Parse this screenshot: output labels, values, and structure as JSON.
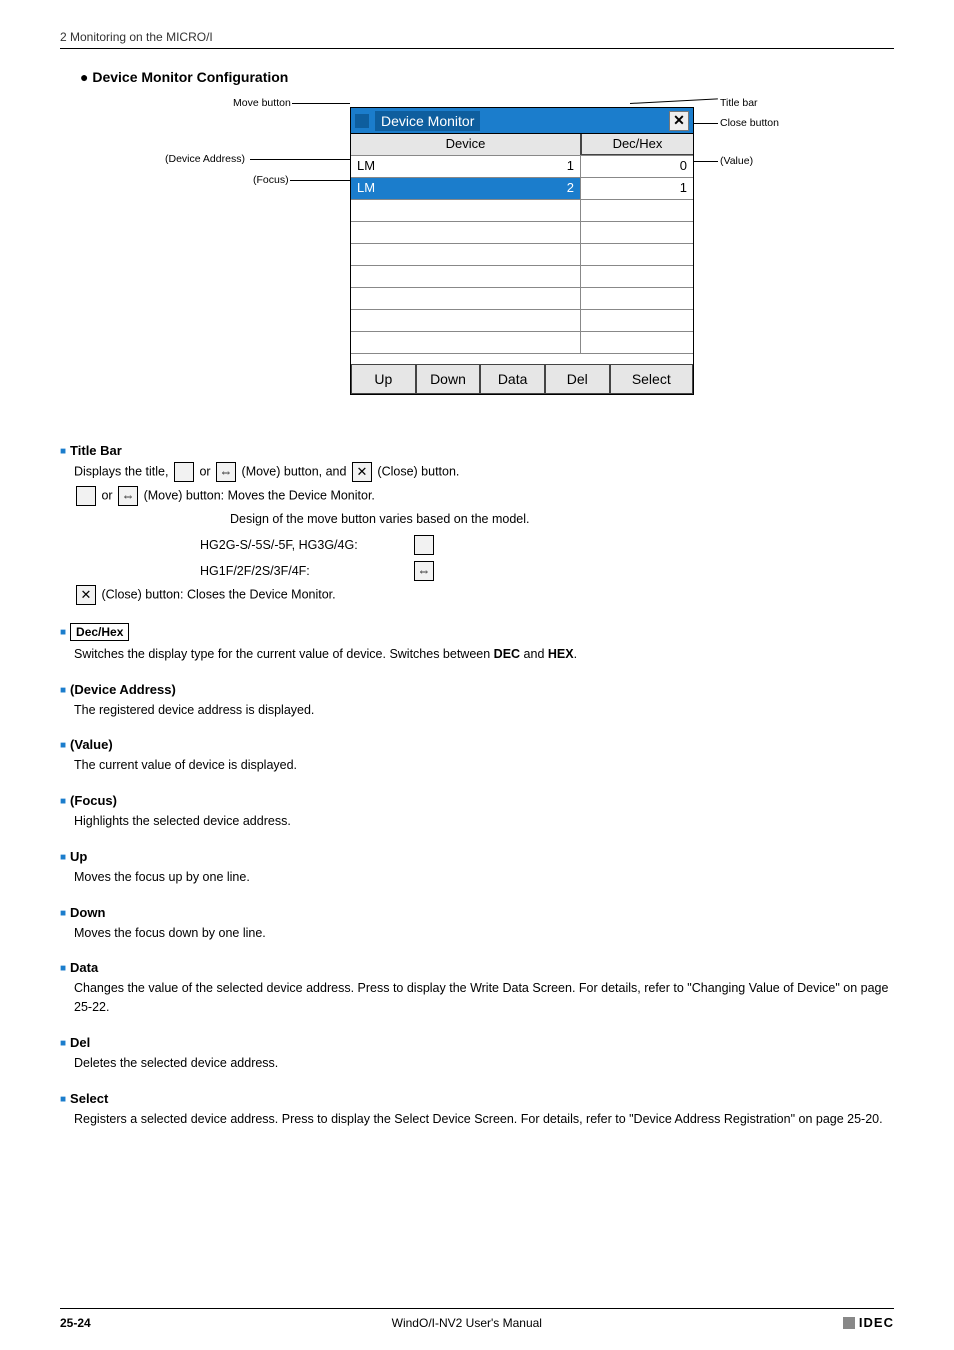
{
  "header": {
    "title": "2 Monitoring on the MICRO/I"
  },
  "section": {
    "title": "● Device Monitor Configuration"
  },
  "callouts": {
    "move_button": "Move button",
    "device_address": "(Device Address)",
    "focus": "(Focus)",
    "title_bar": "Title bar",
    "close_button": "Close button",
    "value": "(Value)"
  },
  "monitor": {
    "title": "Device Monitor",
    "close_glyph": "✕",
    "header_device": "Device",
    "header_dechex": "Dec/Hex",
    "rows": [
      {
        "addr": "LM",
        "num": "1",
        "val": "0"
      },
      {
        "addr": "LM",
        "num": "2",
        "val": "1"
      }
    ],
    "buttons": {
      "up": "Up",
      "down": "Down",
      "data": "Data",
      "del": "Del",
      "select": "Select"
    }
  },
  "definitions": {
    "title_bar": {
      "heading": "Title Bar",
      "line1_prefix": "Displays the title, ",
      "line1_or": " or ",
      "move_glyph": "⇔",
      "line1_mid": " (Move) button, and ",
      "close_glyph": "✕",
      "line1_suffix": "(Close) button.",
      "move_desc": " (Move) button: Moves the Device Monitor.",
      "design_note": "Design of the move button varies based on the model.",
      "model_a": "HG2G-S/-5S/-5F, HG3G/4G:",
      "model_b": "HG1F/2F/2S/3F/4F:",
      "close_desc": " (Close) button: Closes the Device Monitor."
    },
    "dechex": {
      "label": "Dec/Hex",
      "text_a": "Switches the display type for the current value of device. Switches between ",
      "dec": "DEC",
      "and": " and ",
      "hex": "HEX",
      "period": "."
    },
    "device_address": {
      "heading": "(Device Address)",
      "text": "The registered device address is displayed."
    },
    "value": {
      "heading": "(Value)",
      "text": "The current value of device is displayed."
    },
    "focus": {
      "heading": "(Focus)",
      "text": "Highlights the selected device address."
    },
    "up": {
      "heading": "Up",
      "text": "Moves the focus up by one line."
    },
    "down": {
      "heading": "Down",
      "text": "Moves the focus down by one line."
    },
    "data": {
      "heading": "Data",
      "text": "Changes the value of the selected device address. Press to display the Write Data Screen. For details, refer to \"Changing Value of Device\" on page 25-22."
    },
    "del": {
      "heading": "Del",
      "text": "Deletes the selected device address."
    },
    "select": {
      "heading": "Select",
      "text": "Registers a selected device address. Press to display the Select Device Screen. For details, refer to \"Device Address Registration\" on page 25-20."
    }
  },
  "footer": {
    "page": "25-24",
    "manual": "WindO/I-NV2 User's Manual",
    "brand": "IDEC"
  }
}
